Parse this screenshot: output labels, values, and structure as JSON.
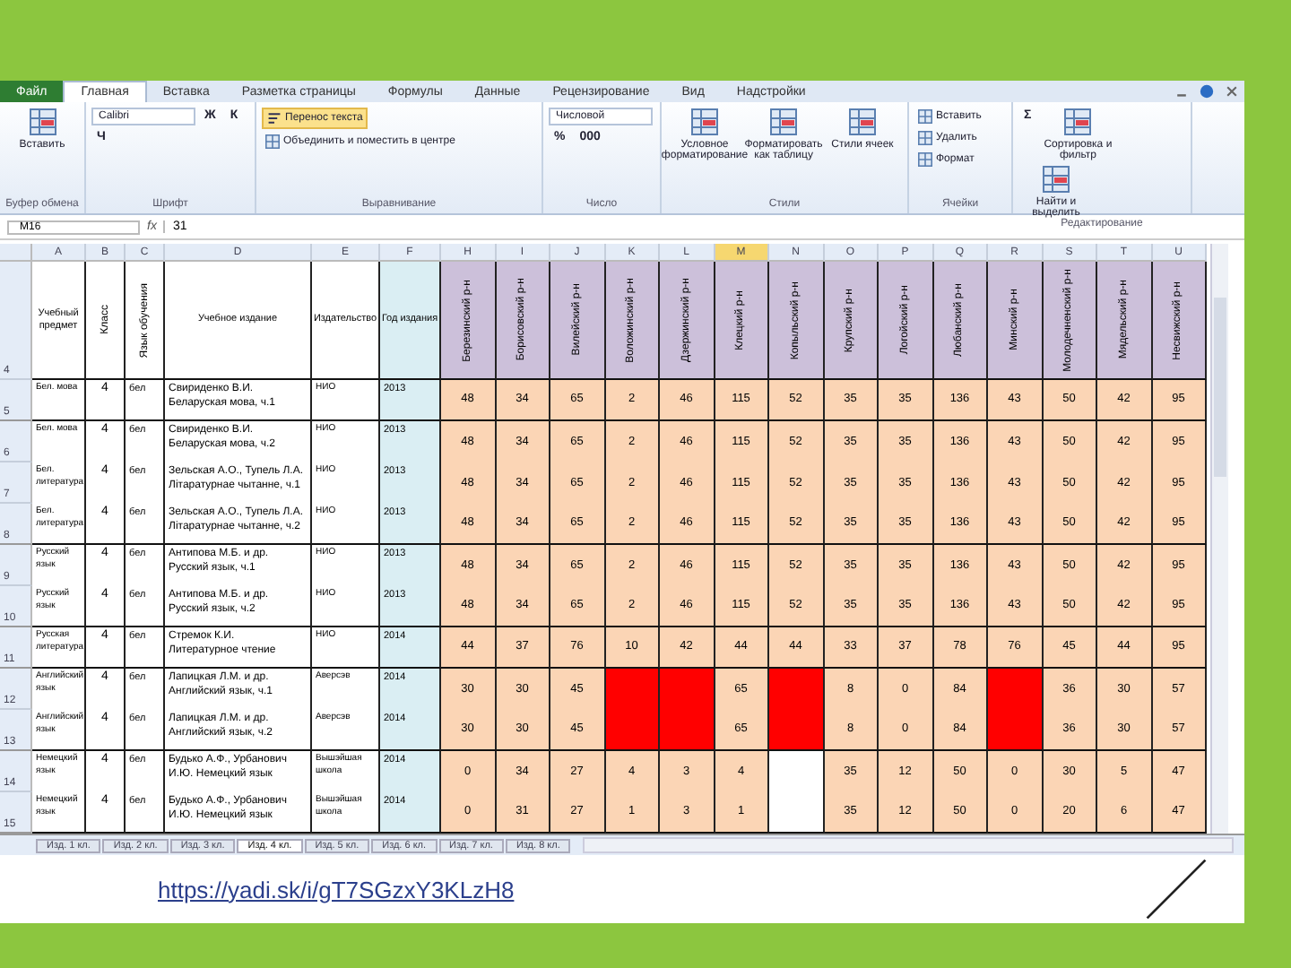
{
  "tabs": [
    {
      "label": "Файл",
      "selected": false,
      "kind": "file"
    },
    {
      "label": "Главная",
      "selected": true,
      "kind": "tab"
    },
    {
      "label": "Вставка",
      "selected": false,
      "kind": "tab"
    },
    {
      "label": "Разметка страницы",
      "selected": false,
      "kind": "tab"
    },
    {
      "label": "Формулы",
      "selected": false,
      "kind": "tab"
    },
    {
      "label": "Данные",
      "selected": false,
      "kind": "tab"
    },
    {
      "label": "Рецензирование",
      "selected": false,
      "kind": "tab"
    },
    {
      "label": "Вид",
      "selected": false,
      "kind": "tab"
    },
    {
      "label": "Надстройки",
      "selected": false,
      "kind": "tab"
    }
  ],
  "ribbon": [
    {
      "label": "Буфер обмена",
      "controls": [
        {
          "kind": "big",
          "label": "Вставить"
        }
      ]
    },
    {
      "label": "Шрифт",
      "controls": [
        {
          "kind": "field",
          "label": "Calibri"
        },
        {
          "kind": "glyph",
          "label": "Ж"
        },
        {
          "kind": "glyph",
          "label": "К"
        },
        {
          "kind": "glyph",
          "label": "Ч"
        }
      ]
    },
    {
      "label": "Выравнивание",
      "controls": [
        {
          "kind": "toggle",
          "label": "Перенос текста",
          "on": true
        },
        {
          "kind": "small",
          "label": "Объединить и поместить в центре"
        }
      ]
    },
    {
      "label": "Число",
      "controls": [
        {
          "kind": "field",
          "label": "Числовой"
        },
        {
          "kind": "glyph",
          "label": "%"
        },
        {
          "kind": "glyph",
          "label": "000"
        }
      ]
    },
    {
      "label": "Стили",
      "controls": [
        {
          "kind": "big",
          "label": "Условное форматирование"
        },
        {
          "kind": "big",
          "label": "Форматировать как таблицу"
        },
        {
          "kind": "big",
          "label": "Стили ячеек"
        }
      ]
    },
    {
      "label": "Ячейки",
      "controls": [
        {
          "kind": "small",
          "label": "Вставить"
        },
        {
          "kind": "small",
          "label": "Удалить"
        },
        {
          "kind": "small",
          "label": "Формат"
        }
      ]
    },
    {
      "label": "Редактирование",
      "controls": [
        {
          "kind": "glyph",
          "label": "Σ"
        },
        {
          "kind": "big",
          "label": "Сортировка и фильтр"
        },
        {
          "kind": "big",
          "label": "Найти и выделить"
        }
      ]
    }
  ],
  "formula_bar": {
    "name_box": "M16",
    "fx": "fx",
    "formula": "31"
  },
  "columns": [
    {
      "letter": "A",
      "selected": false
    },
    {
      "letter": "B",
      "selected": false
    },
    {
      "letter": "C",
      "selected": false
    },
    {
      "letter": "D",
      "selected": false
    },
    {
      "letter": "E",
      "selected": false
    },
    {
      "letter": "F",
      "selected": false
    },
    {
      "letter": "H",
      "selected": false
    },
    {
      "letter": "I",
      "selected": false
    },
    {
      "letter": "J",
      "selected": false
    },
    {
      "letter": "K",
      "selected": false
    },
    {
      "letter": "L",
      "selected": false
    },
    {
      "letter": "M",
      "selected": true
    },
    {
      "letter": "N",
      "selected": false
    },
    {
      "letter": "O",
      "selected": false
    },
    {
      "letter": "P",
      "selected": false
    },
    {
      "letter": "Q",
      "selected": false
    },
    {
      "letter": "R",
      "selected": false
    },
    {
      "letter": "S",
      "selected": false
    },
    {
      "letter": "T",
      "selected": false
    },
    {
      "letter": "U",
      "selected": false
    }
  ],
  "header_row": {
    "number": "4",
    "cells": [
      {
        "kind": "horizontal",
        "text": "Учебный предмет"
      },
      {
        "kind": "vertical",
        "text": "Класс"
      },
      {
        "kind": "vertical",
        "text": "Язык обучения"
      },
      {
        "kind": "horizontal",
        "text": "Учебное издание"
      },
      {
        "kind": "horizontal",
        "text": "Издательство"
      },
      {
        "kind": "horizontal",
        "text": "Год издания"
      },
      {
        "kind": "district",
        "text": "Березинский р-н"
      },
      {
        "kind": "district",
        "text": "Борисовский р-н"
      },
      {
        "kind": "district",
        "text": "Вилейский р-н"
      },
      {
        "kind": "district",
        "text": "Воложинский р-н"
      },
      {
        "kind": "district",
        "text": "Дзержинский р-н"
      },
      {
        "kind": "district",
        "text": "Клецкий р-н"
      },
      {
        "kind": "district",
        "text": "Копыльский р-н"
      },
      {
        "kind": "district",
        "text": "Крупский р-н"
      },
      {
        "kind": "district",
        "text": "Логойский р-н"
      },
      {
        "kind": "district",
        "text": "Любанский р-н"
      },
      {
        "kind": "district",
        "text": "Минский р-н"
      },
      {
        "kind": "district",
        "text": "Молодечненский р-н"
      },
      {
        "kind": "district",
        "text": "Мядельский р-н"
      },
      {
        "kind": "district",
        "text": "Несвижский р-н"
      }
    ]
  },
  "groups": [
    {
      "rows": [
        {
          "number": "5",
          "subject": "Бел. мова",
          "grade": "4",
          "language": "бел",
          "book": "Свириденко В.И. Беларуская мова, ч.1",
          "publisher": "НИО",
          "year": "2013",
          "counts": [
            {
              "kind": "value",
              "text": "48"
            },
            {
              "kind": "value",
              "text": "34"
            },
            {
              "kind": "value",
              "text": "65"
            },
            {
              "kind": "value",
              "text": "2"
            },
            {
              "kind": "value",
              "text": "46"
            },
            {
              "kind": "value",
              "text": "115"
            },
            {
              "kind": "value",
              "text": "52"
            },
            {
              "kind": "value",
              "text": "35"
            },
            {
              "kind": "value",
              "text": "35"
            },
            {
              "kind": "value",
              "text": "136"
            },
            {
              "kind": "value",
              "text": "43"
            },
            {
              "kind": "value",
              "text": "50"
            },
            {
              "kind": "value",
              "text": "42"
            },
            {
              "kind": "value",
              "text": "95"
            }
          ]
        }
      ]
    },
    {
      "rows": [
        {
          "number": "6",
          "subject": "Бел. мова",
          "grade": "4",
          "language": "бел",
          "book": "Свириденко В.И. Беларуская мова, ч.2",
          "publisher": "НИО",
          "year": "2013",
          "counts": [
            {
              "kind": "value",
              "text": "48"
            },
            {
              "kind": "value",
              "text": "34"
            },
            {
              "kind": "value",
              "text": "65"
            },
            {
              "kind": "value",
              "text": "2"
            },
            {
              "kind": "value",
              "text": "46"
            },
            {
              "kind": "value",
              "text": "115"
            },
            {
              "kind": "value",
              "text": "52"
            },
            {
              "kind": "value",
              "text": "35"
            },
            {
              "kind": "value",
              "text": "35"
            },
            {
              "kind": "value",
              "text": "136"
            },
            {
              "kind": "value",
              "text": "43"
            },
            {
              "kind": "value",
              "text": "50"
            },
            {
              "kind": "value",
              "text": "42"
            },
            {
              "kind": "value",
              "text": "95"
            }
          ]
        },
        {
          "number": "7",
          "subject": "Бел. литература",
          "grade": "4",
          "language": "бел",
          "book": "Зельская А.О., Тупель Л.А. Літаратурнае чытанне, ч.1",
          "publisher": "НИО",
          "year": "2013",
          "counts": [
            {
              "kind": "value",
              "text": "48"
            },
            {
              "kind": "value",
              "text": "34"
            },
            {
              "kind": "value",
              "text": "65"
            },
            {
              "kind": "value",
              "text": "2"
            },
            {
              "kind": "value",
              "text": "46"
            },
            {
              "kind": "value",
              "text": "115"
            },
            {
              "kind": "value",
              "text": "52"
            },
            {
              "kind": "value",
              "text": "35"
            },
            {
              "kind": "value",
              "text": "35"
            },
            {
              "kind": "value",
              "text": "136"
            },
            {
              "kind": "value",
              "text": "43"
            },
            {
              "kind": "value",
              "text": "50"
            },
            {
              "kind": "value",
              "text": "42"
            },
            {
              "kind": "value",
              "text": "95"
            }
          ]
        },
        {
          "number": "8",
          "subject": "Бел. литература",
          "grade": "4",
          "language": "бел",
          "book": "Зельская А.О., Тупель Л.А. Літаратурнае чытанне, ч.2",
          "publisher": "НИО",
          "year": "2013",
          "counts": [
            {
              "kind": "value",
              "text": "48"
            },
            {
              "kind": "value",
              "text": "34"
            },
            {
              "kind": "value",
              "text": "65"
            },
            {
              "kind": "value",
              "text": "2"
            },
            {
              "kind": "value",
              "text": "46"
            },
            {
              "kind": "value",
              "text": "115"
            },
            {
              "kind": "value",
              "text": "52"
            },
            {
              "kind": "value",
              "text": "35"
            },
            {
              "kind": "value",
              "text": "35"
            },
            {
              "kind": "value",
              "text": "136"
            },
            {
              "kind": "value",
              "text": "43"
            },
            {
              "kind": "value",
              "text": "50"
            },
            {
              "kind": "value",
              "text": "42"
            },
            {
              "kind": "value",
              "text": "95"
            }
          ]
        }
      ]
    },
    {
      "rows": [
        {
          "number": "9",
          "subject": "Русский язык",
          "grade": "4",
          "language": "бел",
          "book": "Антипова М.Б. и др. Русский язык, ч.1",
          "publisher": "НИО",
          "year": "2013",
          "counts": [
            {
              "kind": "value",
              "text": "48"
            },
            {
              "kind": "value",
              "text": "34"
            },
            {
              "kind": "value",
              "text": "65"
            },
            {
              "kind": "value",
              "text": "2"
            },
            {
              "kind": "value",
              "text": "46"
            },
            {
              "kind": "value",
              "text": "115"
            },
            {
              "kind": "value",
              "text": "52"
            },
            {
              "kind": "value",
              "text": "35"
            },
            {
              "kind": "value",
              "text": "35"
            },
            {
              "kind": "value",
              "text": "136"
            },
            {
              "kind": "value",
              "text": "43"
            },
            {
              "kind": "value",
              "text": "50"
            },
            {
              "kind": "value",
              "text": "42"
            },
            {
              "kind": "value",
              "text": "95"
            }
          ]
        },
        {
          "number": "10",
          "subject": "Русский язык",
          "grade": "4",
          "language": "бел",
          "book": "Антипова М.Б. и др. Русский язык, ч.2",
          "publisher": "НИО",
          "year": "2013",
          "counts": [
            {
              "kind": "value",
              "text": "48"
            },
            {
              "kind": "value",
              "text": "34"
            },
            {
              "kind": "value",
              "text": "65"
            },
            {
              "kind": "value",
              "text": "2"
            },
            {
              "kind": "value",
              "text": "46"
            },
            {
              "kind": "value",
              "text": "115"
            },
            {
              "kind": "value",
              "text": "52"
            },
            {
              "kind": "value",
              "text": "35"
            },
            {
              "kind": "value",
              "text": "35"
            },
            {
              "kind": "value",
              "text": "136"
            },
            {
              "kind": "value",
              "text": "43"
            },
            {
              "kind": "value",
              "text": "50"
            },
            {
              "kind": "value",
              "text": "42"
            },
            {
              "kind": "value",
              "text": "95"
            }
          ]
        }
      ]
    },
    {
      "rows": [
        {
          "number": "11",
          "subject": "Русская литература",
          "grade": "4",
          "language": "бел",
          "book": "Стремок К.И. Литературное чтение",
          "publisher": "НИО",
          "year": "2014",
          "counts": [
            {
              "kind": "value",
              "text": "44"
            },
            {
              "kind": "value",
              "text": "37"
            },
            {
              "kind": "value",
              "text": "76"
            },
            {
              "kind": "value",
              "text": "10"
            },
            {
              "kind": "value",
              "text": "42"
            },
            {
              "kind": "value",
              "text": "44"
            },
            {
              "kind": "value",
              "text": "44"
            },
            {
              "kind": "value",
              "text": "33"
            },
            {
              "kind": "value",
              "text": "37"
            },
            {
              "kind": "value",
              "text": "78"
            },
            {
              "kind": "value",
              "text": "76"
            },
            {
              "kind": "value",
              "text": "45"
            },
            {
              "kind": "value",
              "text": "44"
            },
            {
              "kind": "value",
              "text": "95"
            }
          ]
        }
      ]
    },
    {
      "rows": [
        {
          "number": "12",
          "subject": "Английский язык",
          "grade": "4",
          "language": "бел",
          "book": "Лапицкая Л.М. и др. Английский язык, ч.1",
          "publisher": "Аверсэв",
          "year": "2014",
          "counts": [
            {
              "kind": "value",
              "text": "30"
            },
            {
              "kind": "value",
              "text": "30"
            },
            {
              "kind": "value",
              "text": "45"
            },
            {
              "kind": "red"
            },
            {
              "kind": "red"
            },
            {
              "kind": "value",
              "text": "65"
            },
            {
              "kind": "red"
            },
            {
              "kind": "value",
              "text": "8"
            },
            {
              "kind": "value",
              "text": "0"
            },
            {
              "kind": "value",
              "text": "84"
            },
            {
              "kind": "red"
            },
            {
              "kind": "value",
              "text": "36"
            },
            {
              "kind": "value",
              "text": "30"
            },
            {
              "kind": "value",
              "text": "57"
            }
          ]
        },
        {
          "number": "13",
          "subject": "Английский язык",
          "grade": "4",
          "language": "бел",
          "book": "Лапицкая Л.М. и др. Английский язык, ч.2",
          "publisher": "Аверсэв",
          "year": "2014",
          "counts": [
            {
              "kind": "value",
              "text": "30"
            },
            {
              "kind": "value",
              "text": "30"
            },
            {
              "kind": "value",
              "text": "45"
            },
            {
              "kind": "red"
            },
            {
              "kind": "red"
            },
            {
              "kind": "value",
              "text": "65"
            },
            {
              "kind": "red"
            },
            {
              "kind": "value",
              "text": "8"
            },
            {
              "kind": "value",
              "text": "0"
            },
            {
              "kind": "value",
              "text": "84"
            },
            {
              "kind": "red"
            },
            {
              "kind": "value",
              "text": "36"
            },
            {
              "kind": "value",
              "text": "30"
            },
            {
              "kind": "value",
              "text": "57"
            }
          ]
        }
      ]
    },
    {
      "rows": [
        {
          "number": "14",
          "subject": "Немецкий язык",
          "grade": "4",
          "language": "бел",
          "book": "Будько А.Ф., Урбанович И.Ю. Немецкий язык",
          "publisher": "Вышэйшая школа",
          "year": "2014",
          "counts": [
            {
              "kind": "value",
              "text": "0"
            },
            {
              "kind": "value",
              "text": "34"
            },
            {
              "kind": "value",
              "text": "27"
            },
            {
              "kind": "value",
              "text": "4"
            },
            {
              "kind": "value",
              "text": "3"
            },
            {
              "kind": "value",
              "text": "4"
            },
            {
              "kind": "blank"
            },
            {
              "kind": "value",
              "text": "35"
            },
            {
              "kind": "value",
              "text": "12"
            },
            {
              "kind": "value",
              "text": "50"
            },
            {
              "kind": "value",
              "text": "0"
            },
            {
              "kind": "value",
              "text": "30"
            },
            {
              "kind": "value",
              "text": "5"
            },
            {
              "kind": "value",
              "text": "47"
            }
          ]
        },
        {
          "number": "15",
          "subject": "Немецкий язык",
          "grade": "4",
          "language": "бел",
          "book": "Будько А.Ф., Урбанович И.Ю. Немецкий язык",
          "publisher": "Вышэйшая школа",
          "year": "2014",
          "counts": [
            {
              "kind": "value",
              "text": "0"
            },
            {
              "kind": "value",
              "text": "31"
            },
            {
              "kind": "value",
              "text": "27"
            },
            {
              "kind": "value",
              "text": "1"
            },
            {
              "kind": "value",
              "text": "3"
            },
            {
              "kind": "value",
              "text": "1"
            },
            {
              "kind": "blank"
            },
            {
              "kind": "value",
              "text": "35"
            },
            {
              "kind": "value",
              "text": "12"
            },
            {
              "kind": "value",
              "text": "50"
            },
            {
              "kind": "value",
              "text": "0"
            },
            {
              "kind": "value",
              "text": "20"
            },
            {
              "kind": "value",
              "text": "6"
            },
            {
              "kind": "value",
              "text": "47"
            }
          ]
        }
      ]
    }
  ],
  "sheet_tabs": [
    {
      "label": "Изд. 1 кл.",
      "selected": false
    },
    {
      "label": "Изд. 2 кл.",
      "selected": false
    },
    {
      "label": "Изд. 3 кл.",
      "selected": false
    },
    {
      "label": "Изд. 4 кл.",
      "selected": true
    },
    {
      "label": "Изд. 5 кл.",
      "selected": false
    },
    {
      "label": "Изд. 6 кл.",
      "selected": false
    },
    {
      "label": "Изд. 7 кл.",
      "selected": false
    },
    {
      "label": "Изд. 8 кл.",
      "selected": false
    }
  ],
  "link": "https://yadi.sk/i/gT7SGzxY3KLzH8"
}
